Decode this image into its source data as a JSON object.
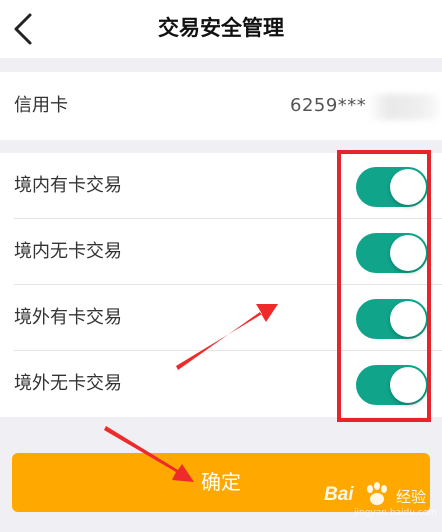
{
  "header": {
    "title": "交易安全管理",
    "back_icon": "chevron-left-icon"
  },
  "card": {
    "label": "信用卡",
    "number": "6259***"
  },
  "settings": [
    {
      "label": "境内有卡交易",
      "enabled": true
    },
    {
      "label": "境内无卡交易",
      "enabled": true
    },
    {
      "label": "境外有卡交易",
      "enabled": true
    },
    {
      "label": "境外无卡交易",
      "enabled": true
    }
  ],
  "confirm": {
    "label": "确定"
  },
  "watermark": {
    "brand_left": "Bai",
    "brand_right": "经验",
    "domain": "jingyan.baidu.com"
  },
  "colors": {
    "toggle_on": "#10a58b",
    "button": "#ffa800",
    "annotation": "#e8232c",
    "background": "#efeff4"
  }
}
